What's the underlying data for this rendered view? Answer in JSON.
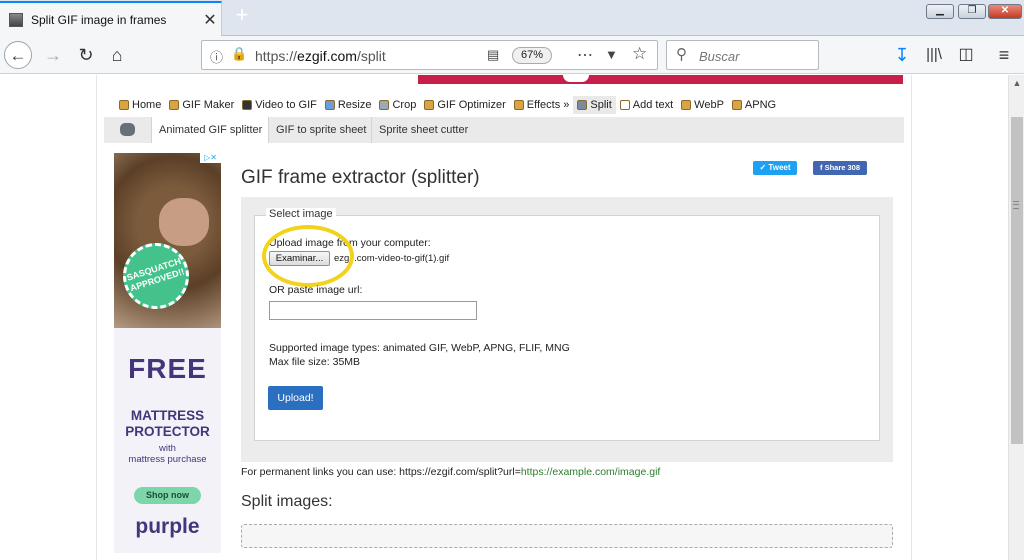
{
  "browser": {
    "tab_title": "Split GIF image in frames",
    "tab_close": "✕",
    "new_tab": "+",
    "url_prefix": "https://",
    "url_host": "ezgif.com",
    "url_path": "/split",
    "zoom": "67%",
    "search_placeholder": "Buscar",
    "win_min": "▁",
    "win_max": "❐",
    "win_close": "✕"
  },
  "site": {
    "nav": [
      {
        "label": "Home"
      },
      {
        "label": "GIF Maker"
      },
      {
        "label": "Video to GIF"
      },
      {
        "label": "Resize"
      },
      {
        "label": "Crop"
      },
      {
        "label": "GIF Optimizer"
      },
      {
        "label": "Effects »"
      },
      {
        "label": "Split"
      },
      {
        "label": "Add text"
      },
      {
        "label": "WebP"
      },
      {
        "label": "APNG"
      }
    ],
    "subnav": [
      {
        "label": "Animated GIF splitter"
      },
      {
        "label": "GIF to sprite sheet"
      },
      {
        "label": "Sprite sheet cutter"
      }
    ],
    "tweet": "Tweet",
    "share": "Share 308",
    "heading": "GIF frame extractor (splitter)",
    "form": {
      "legend": "Select image",
      "upload_label": "Upload image from your computer:",
      "browse_button": "Examinar...",
      "file_name": "ezgif.com-video-to-gif(1).gif",
      "url_label": "OR paste image url:",
      "url_value": "",
      "supported": "Supported image types: animated GIF, WebP, APNG, FLIF, MNG",
      "max_size": "Max file size: 35MB",
      "submit": "Upload!"
    },
    "permalink_text": "For permanent links you can use: https://ezgif.com/split?url=",
    "permalink_example": "https://example.com/image.gif",
    "split_heading": "Split images:"
  },
  "ad": {
    "badge": "SASQUATCH APPROVED!!",
    "line1": "FREE",
    "line2": "MATTRESS",
    "line3": "PROTECTOR",
    "line4": "with",
    "line5": "mattress purchase",
    "cta": "Shop now",
    "brand": "purple"
  },
  "colors": {
    "accent": "#2b6fc1",
    "highlight": "#f2d21b"
  }
}
